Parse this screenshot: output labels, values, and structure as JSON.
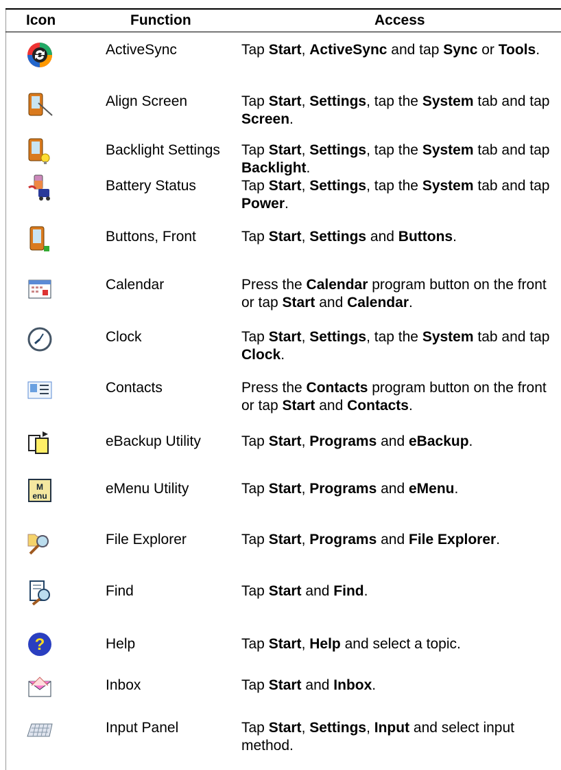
{
  "headers": {
    "icon": "Icon",
    "function": "Function",
    "access": "Access"
  },
  "rows": [
    {
      "icon": "activesync-icon",
      "function": "ActiveSync",
      "access": [
        [
          "Tap ",
          0
        ],
        [
          "Start",
          1
        ],
        [
          ", ",
          0
        ],
        [
          "ActiveSync",
          1
        ],
        [
          " and tap ",
          0
        ],
        [
          "Sync",
          1
        ],
        [
          " or ",
          0
        ],
        [
          "Tools",
          1
        ],
        [
          ".",
          0
        ]
      ]
    },
    {
      "icon": "align-screen-icon",
      "function": "Align Screen",
      "access": [
        [
          "Tap ",
          0
        ],
        [
          "Start",
          1
        ],
        [
          ", ",
          0
        ],
        [
          "Settings",
          1
        ],
        [
          ", tap the ",
          0
        ],
        [
          "System",
          1
        ],
        [
          " tab and tap ",
          0
        ],
        [
          "Screen",
          1
        ],
        [
          ".",
          0
        ]
      ]
    },
    {
      "icon": "backlight-icon",
      "function": "Backlight Settings",
      "access": [
        [
          "Tap ",
          0
        ],
        [
          "Start",
          1
        ],
        [
          ", ",
          0
        ],
        [
          "Settings",
          1
        ],
        [
          ", tap the ",
          0
        ],
        [
          "System",
          1
        ],
        [
          " tab and tap ",
          0
        ],
        [
          "Backlight",
          1
        ],
        [
          ".",
          0
        ]
      ]
    },
    {
      "icon": "battery-icon",
      "function": "Battery Status",
      "access": [
        [
          "Tap ",
          0
        ],
        [
          "Start",
          1
        ],
        [
          ", ",
          0
        ],
        [
          "Settings",
          1
        ],
        [
          ", tap the ",
          0
        ],
        [
          "System",
          1
        ],
        [
          " tab and tap ",
          0
        ],
        [
          "Power",
          1
        ],
        [
          ".",
          0
        ]
      ]
    },
    {
      "icon": "buttons-icon",
      "function": "Buttons, Front",
      "access": [
        [
          "Tap ",
          0
        ],
        [
          "Start",
          1
        ],
        [
          ", ",
          0
        ],
        [
          "Settings",
          1
        ],
        [
          " and ",
          0
        ],
        [
          "Buttons",
          1
        ],
        [
          ".",
          0
        ]
      ]
    },
    {
      "icon": "calendar-icon",
      "function": "Calendar",
      "access": [
        [
          "Press the ",
          0
        ],
        [
          "Calendar",
          1
        ],
        [
          " program button on the front or tap ",
          0
        ],
        [
          "Start",
          1
        ],
        [
          " and ",
          0
        ],
        [
          "Calendar",
          1
        ],
        [
          ".",
          0
        ]
      ]
    },
    {
      "icon": "clock-icon",
      "function": "Clock",
      "access": [
        [
          "Tap ",
          0
        ],
        [
          "Start",
          1
        ],
        [
          ", ",
          0
        ],
        [
          "Settings",
          1
        ],
        [
          ", tap the ",
          0
        ],
        [
          "System",
          1
        ],
        [
          " tab and tap ",
          0
        ],
        [
          "Clock",
          1
        ],
        [
          ".",
          0
        ]
      ]
    },
    {
      "icon": "contacts-icon",
      "function": "Contacts",
      "access": [
        [
          "Press the ",
          0
        ],
        [
          "Contacts",
          1
        ],
        [
          " program button on the front or tap ",
          0
        ],
        [
          "Start",
          1
        ],
        [
          " and ",
          0
        ],
        [
          "Contacts",
          1
        ],
        [
          ".",
          0
        ]
      ]
    },
    {
      "icon": "ebackup-icon",
      "function": "eBackup Utility",
      "access": [
        [
          "Tap ",
          0
        ],
        [
          "Start",
          1
        ],
        [
          ", ",
          0
        ],
        [
          "Programs",
          1
        ],
        [
          " and ",
          0
        ],
        [
          "eBackup",
          1
        ],
        [
          ".",
          0
        ]
      ]
    },
    {
      "icon": "emenu-icon",
      "function": "eMenu Utility",
      "access": [
        [
          "Tap ",
          0
        ],
        [
          "Start",
          1
        ],
        [
          ", ",
          0
        ],
        [
          "Programs",
          1
        ],
        [
          " and ",
          0
        ],
        [
          "eMenu",
          1
        ],
        [
          ".",
          0
        ]
      ]
    },
    {
      "icon": "file-explorer-icon",
      "function": "File Explorer",
      "access": [
        [
          "Tap ",
          0
        ],
        [
          "Start",
          1
        ],
        [
          ", ",
          0
        ],
        [
          "Programs",
          1
        ],
        [
          " and ",
          0
        ],
        [
          "File Explorer",
          1
        ],
        [
          ".",
          0
        ]
      ]
    },
    {
      "icon": "find-icon",
      "function": "Find",
      "access": [
        [
          "Tap ",
          0
        ],
        [
          "Start",
          1
        ],
        [
          " and ",
          0
        ],
        [
          "Find",
          1
        ],
        [
          ".",
          0
        ]
      ]
    },
    {
      "icon": "help-icon",
      "function": "Help",
      "access": [
        [
          "Tap ",
          0
        ],
        [
          "Start",
          1
        ],
        [
          ", ",
          0
        ],
        [
          "Help",
          1
        ],
        [
          " and select a topic.",
          0
        ]
      ]
    },
    {
      "icon": "inbox-icon",
      "function": "Inbox",
      "access": [
        [
          "Tap ",
          0
        ],
        [
          "Start",
          1
        ],
        [
          " and ",
          0
        ],
        [
          "Inbox",
          1
        ],
        [
          ".",
          0
        ]
      ]
    },
    {
      "icon": "input-panel-icon",
      "function": "Input Panel",
      "access": [
        [
          "Tap ",
          0
        ],
        [
          "Start",
          1
        ],
        [
          ", ",
          0
        ],
        [
          "Settings",
          1
        ],
        [
          ", ",
          0
        ],
        [
          "Input",
          1
        ],
        [
          " and select input method.",
          0
        ]
      ]
    }
  ]
}
